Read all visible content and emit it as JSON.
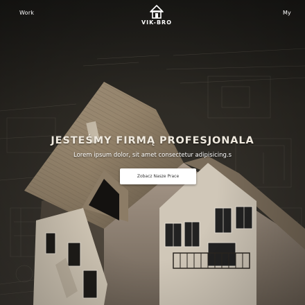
{
  "nav": {
    "left_link": "Work",
    "right_link": "My"
  },
  "logo": {
    "icon": "house-icon",
    "text": "VIK-BRO"
  },
  "hero": {
    "background": "house-on-blueprints-photo",
    "headline": "JESTEŚMY FIRMĄ PROFESJONALA",
    "subheadline": "Lorem ipsum dolor, sit amet consectetur adipisicing.s",
    "cta_label": "Zobacz Nasze Prace"
  },
  "colors": {
    "overlay": "#1b1a17",
    "headline": "#f0eadf",
    "cta_bg": "#ffffff",
    "cta_text": "#333333"
  }
}
